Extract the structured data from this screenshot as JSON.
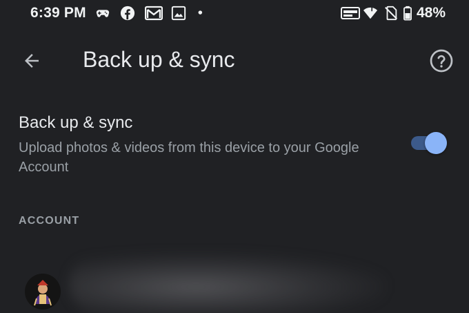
{
  "status_bar": {
    "time": "6:39 PM",
    "battery_percent": "48%",
    "notification_icons": [
      "gamepad-icon",
      "facebook-icon",
      "gmail-icon",
      "photos-icon",
      "dot-icon"
    ],
    "system_icons": [
      "hd-voice-icon",
      "wifi-icon",
      "no-sim-icon",
      "battery-icon"
    ]
  },
  "app_bar": {
    "title": "Back up & sync",
    "back_icon": "arrow-left-icon",
    "help_icon": "help-circle-icon"
  },
  "setting": {
    "title": "Back up & sync",
    "description": "Upload photos & videos from this device to your Google Account",
    "enabled": true
  },
  "account_section": {
    "header": "ACCOUNT"
  },
  "colors": {
    "background": "#202124",
    "accent": "#8ab4f8",
    "secondary_text": "#9aa0a6"
  }
}
